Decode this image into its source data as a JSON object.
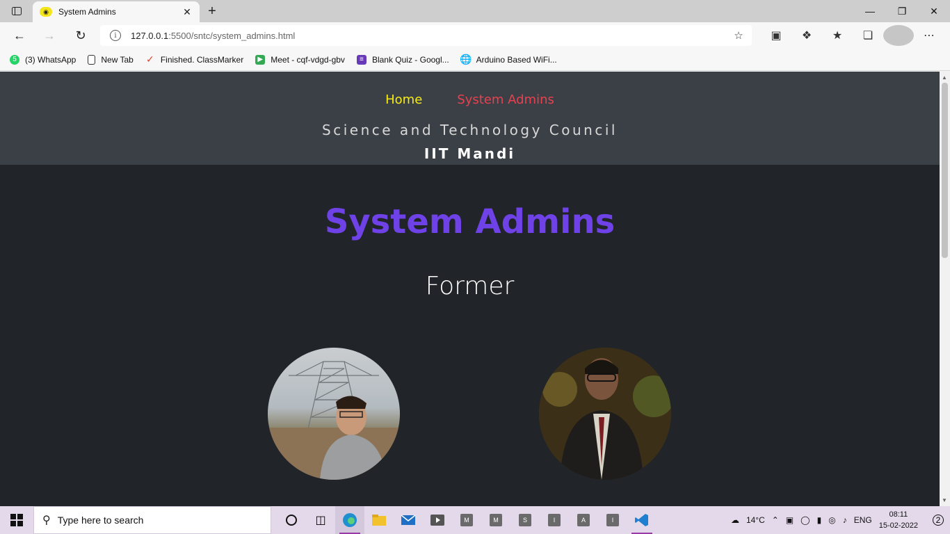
{
  "browser": {
    "tab_title": "System Admins",
    "url_host": "127.0.0.1",
    "url_path": ":5500/sntc/system_admins.html",
    "bookmarks": [
      {
        "label": "(3) WhatsApp",
        "icon": "whatsapp-icon",
        "color": "#25d366"
      },
      {
        "label": "New Tab",
        "icon": "page-icon",
        "color": "#ffffff"
      },
      {
        "label": "Finished. ClassMarker",
        "icon": "checkmark-icon",
        "color": "#d9442f"
      },
      {
        "label": "Meet - cqf-vdgd-gbv",
        "icon": "meet-icon",
        "color": "#34a853"
      },
      {
        "label": "Blank Quiz - Googl...",
        "icon": "forms-icon",
        "color": "#673ab7"
      },
      {
        "label": "Arduino Based WiFi...",
        "icon": "globe-icon",
        "color": "#3a8fd8"
      }
    ]
  },
  "site": {
    "nav": {
      "home": "Home",
      "system_admins": "System Admins"
    },
    "council": "Science and Technology Council",
    "institute": "IIT Mandi",
    "page_title": "System Admins",
    "section": "Former"
  },
  "taskbar": {
    "search_placeholder": "Type here to search",
    "temperature": "14°C",
    "language": "ENG",
    "time": "08:11",
    "date": "15-02-2022",
    "notifications": "2",
    "pinned": [
      "M",
      "M",
      "S",
      "I",
      "A",
      "I"
    ]
  },
  "colors": {
    "home_link": "#f6eb16",
    "active_link": "#e8404f",
    "title": "#6f42e8",
    "header_bg": "#3b4046",
    "page_bg": "#212529"
  }
}
